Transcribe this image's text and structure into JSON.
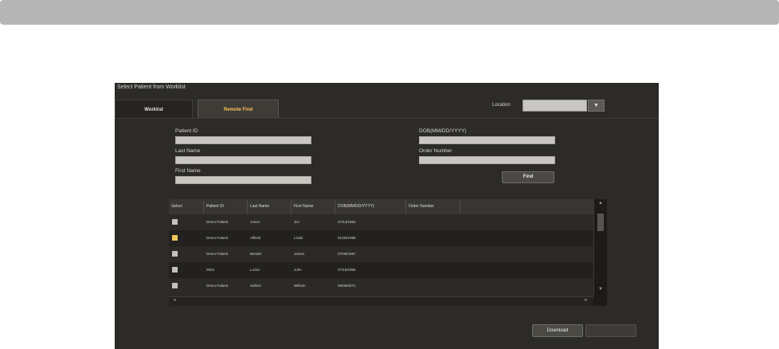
{
  "dialog": {
    "title": "Select Patient from Worklist",
    "tabs": [
      {
        "label": "Worklist",
        "active": false
      },
      {
        "label": "Remote Find",
        "active": true
      }
    ],
    "location": {
      "label": "Location",
      "value": ""
    }
  },
  "form": {
    "patient_id": {
      "label": "Patient ID",
      "value": ""
    },
    "last_name": {
      "label": "Last Name",
      "value": ""
    },
    "first_name": {
      "label": "First Name",
      "value": ""
    },
    "dob": {
      "label": "DOB(MM/DD/YYYY)",
      "value": ""
    },
    "order_number": {
      "label": "Order Number",
      "value": ""
    },
    "find_label": "Find"
  },
  "table": {
    "columns": [
      "Select",
      "Patient ID",
      "Last Name",
      "First Name",
      "DOB(MM/DD/YYYY)",
      "Order Number"
    ],
    "rows": [
      {
        "selected": false,
        "patient_id": "Demo Patient",
        "last_name": "Jones",
        "first_name": "Jim",
        "dob": "07/14/1962",
        "order_number": ""
      },
      {
        "selected": true,
        "patient_id": "Demo Patient",
        "last_name": "Alfleck",
        "first_name": "Linda",
        "dob": "01/30/1998",
        "order_number": ""
      },
      {
        "selected": false,
        "patient_id": "Demo Patient",
        "last_name": "Bender",
        "first_name": "James",
        "dob": "07/08/1997",
        "order_number": ""
      },
      {
        "selected": false,
        "patient_id": "0004",
        "last_name": "Locke",
        "first_name": "John",
        "dob": "07/15/1985",
        "order_number": ""
      },
      {
        "selected": false,
        "patient_id": "Demo Patient",
        "last_name": "Sellers",
        "first_name": "William",
        "dob": "06/06/2071",
        "order_number": ""
      }
    ]
  },
  "footer": {
    "download_label": "Download",
    "secondary_label": ""
  },
  "colors": {
    "accent": "#ffc15a",
    "checked": "#f0c65c",
    "dialog_bg": "#2c2b28",
    "top_bar": "#b5b5b5"
  }
}
